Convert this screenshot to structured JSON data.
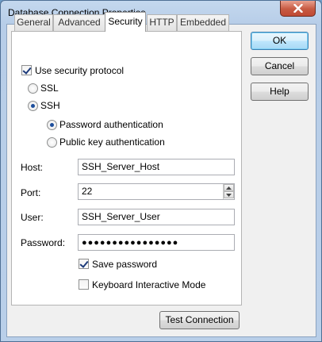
{
  "window": {
    "title": "Database Connection Properties"
  },
  "tabs": [
    {
      "label": "General",
      "active": false
    },
    {
      "label": "Advanced",
      "active": false
    },
    {
      "label": "Security",
      "active": true
    },
    {
      "label": "HTTP",
      "active": false
    },
    {
      "label": "Embedded",
      "active": false
    }
  ],
  "security": {
    "use_protocol_label": "Use security protocol",
    "use_protocol_checked": true,
    "ssl_label": "SSL",
    "ssh_label": "SSH",
    "selected_protocol": "SSH",
    "password_auth_label": "Password authentication",
    "public_key_auth_label": "Public key authentication",
    "selected_auth": "Password authentication"
  },
  "form": {
    "host_label": "Host:",
    "host_value": "SSH_Server_Host",
    "port_label": "Port:",
    "port_value": "22",
    "user_label": "User:",
    "user_value": "SSH_Server_User",
    "password_label": "Password:",
    "password_mask": "●●●●●●●●●●●●●●●●",
    "save_password_label": "Save password",
    "save_password_checked": true,
    "keyboard_interactive_label": "Keyboard Interactive Mode",
    "keyboard_interactive_checked": false
  },
  "buttons": {
    "ok": "OK",
    "cancel": "Cancel",
    "help": "Help",
    "test_connection": "Test Connection"
  },
  "icons": {
    "close": "close-icon",
    "spin_up": "chevron-up-icon",
    "spin_down": "chevron-down-icon"
  }
}
